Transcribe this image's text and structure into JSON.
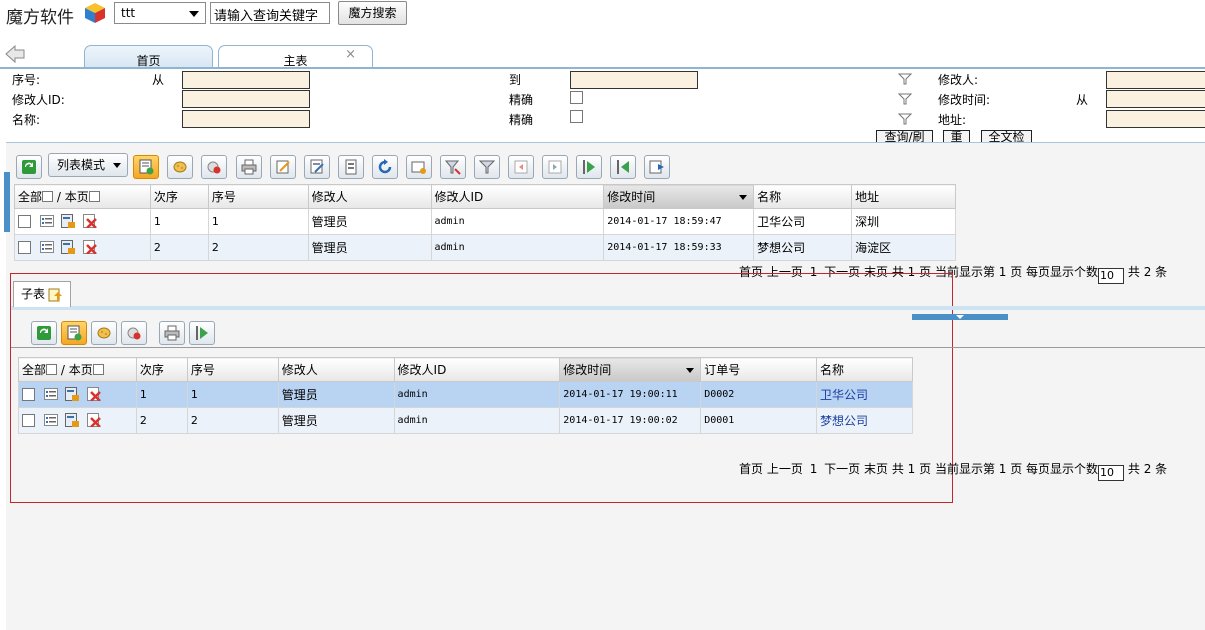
{
  "app": {
    "logo_text": "魔方软件",
    "select_value": "ttt",
    "keyword_input": "请输入查询关键字",
    "search_button": "魔方搜索"
  },
  "tabs": [
    {
      "label": "首页"
    },
    {
      "label": "主表",
      "close": "×"
    }
  ],
  "query": {
    "seq_label": "序号:",
    "from_label": "从",
    "to_label": "到",
    "modifier_id_label": "修改人ID:",
    "exact_label_1": "精确",
    "name_label": "名称:",
    "exact_label_2": "精确",
    "modifier_label": "修改人:",
    "modify_time_label": "修改时间:",
    "modify_time_from": "从",
    "address_label": "地址:",
    "btn_query": "查询/刷新",
    "btn_reset": "重置",
    "btn_fulltext": "全文检索"
  },
  "toolbar": {
    "mode_label": "列表模式"
  },
  "main_table": {
    "select_all": "全部",
    "select_page": "/ 本页",
    "columns": [
      "次序",
      "序号",
      "修改人",
      "修改人ID",
      "修改时间",
      "名称",
      "地址"
    ],
    "rows": [
      {
        "order": "1",
        "seq": "1",
        "modifier": "管理员",
        "modifier_id": "admin",
        "time": "2014-01-17 18:59:47",
        "name": "卫华公司",
        "address": "深圳"
      },
      {
        "order": "2",
        "seq": "2",
        "modifier": "管理员",
        "modifier_id": "admin",
        "time": "2014-01-17 18:59:33",
        "name": "梦想公司",
        "address": "海淀区"
      }
    ]
  },
  "pager1": {
    "first": "首页",
    "prev": "上一页",
    "page": "1",
    "next": "下一页",
    "last": "末页",
    "total_pages": "共 1 页",
    "current": "当前显示第 1 页",
    "per_page_label": "每页显示个数",
    "per_page": "10",
    "total": "共 2 条"
  },
  "sub": {
    "tab_label": "子表",
    "table": {
      "select_all": "全部",
      "select_page": "/ 本页",
      "columns": [
        "次序",
        "序号",
        "修改人",
        "修改人ID",
        "修改时间",
        "订单号",
        "名称"
      ],
      "rows": [
        {
          "order": "1",
          "seq": "1",
          "modifier": "管理员",
          "modifier_id": "admin",
          "time": "2014-01-17 19:00:11",
          "order_no": "D0002",
          "name": "卫华公司"
        },
        {
          "order": "2",
          "seq": "2",
          "modifier": "管理员",
          "modifier_id": "admin",
          "time": "2014-01-17 19:00:02",
          "order_no": "D0001",
          "name": "梦想公司"
        }
      ]
    },
    "pager": {
      "first": "首页",
      "prev": "上一页",
      "page": "1",
      "next": "下一页",
      "last": "末页",
      "total_pages": "共 1 页",
      "current": "当前显示第 1 页",
      "per_page_label": "每页显示个数",
      "per_page": "10",
      "total": "共 2 条"
    }
  }
}
